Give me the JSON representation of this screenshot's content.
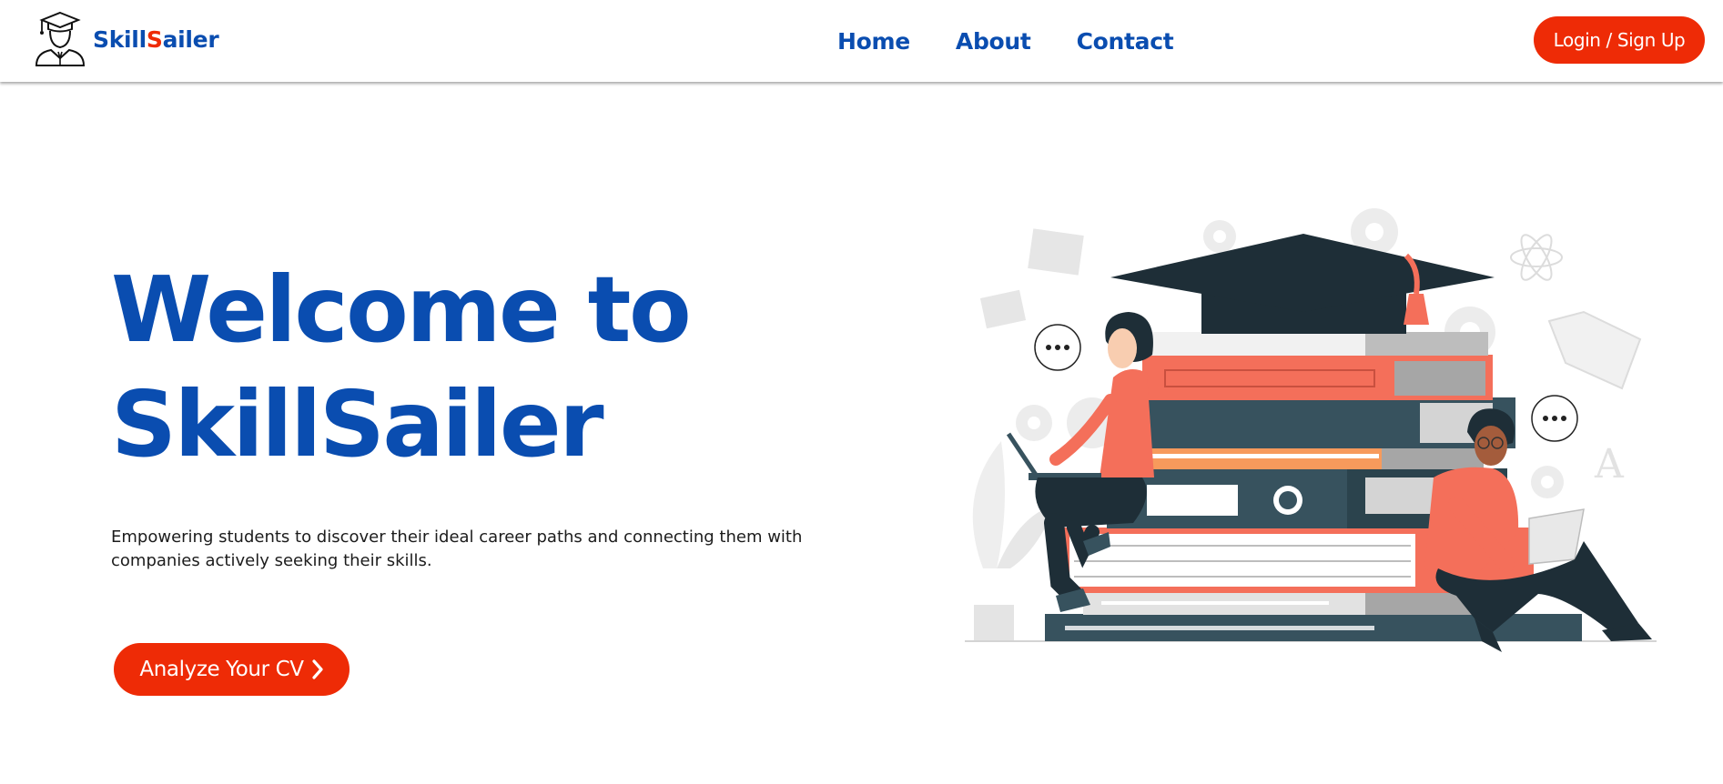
{
  "brand": {
    "name_part1": "Skill",
    "name_accent": "S",
    "name_part2": "ailer",
    "logo_icon": "graduate-icon"
  },
  "nav": {
    "items": [
      {
        "label": "Home"
      },
      {
        "label": "About"
      },
      {
        "label": "Contact"
      }
    ],
    "login_label": "Login / Sign Up"
  },
  "hero": {
    "title_line1": "Welcome to",
    "title_line2": "SkillSailer",
    "subtitle": "Empowering students to discover their ideal career paths and connecting them with companies actively seeking their skills.",
    "cta_label": "Analyze Your CV",
    "cta_icon": "chevron-right-icon",
    "illustration_icon": "students-with-books-illustration"
  },
  "colors": {
    "brand_blue": "#0a4db0",
    "accent_red": "#ee2b06",
    "coral": "#f46f5a",
    "dark_navy": "#1e2e37",
    "slate": "#37525e"
  }
}
